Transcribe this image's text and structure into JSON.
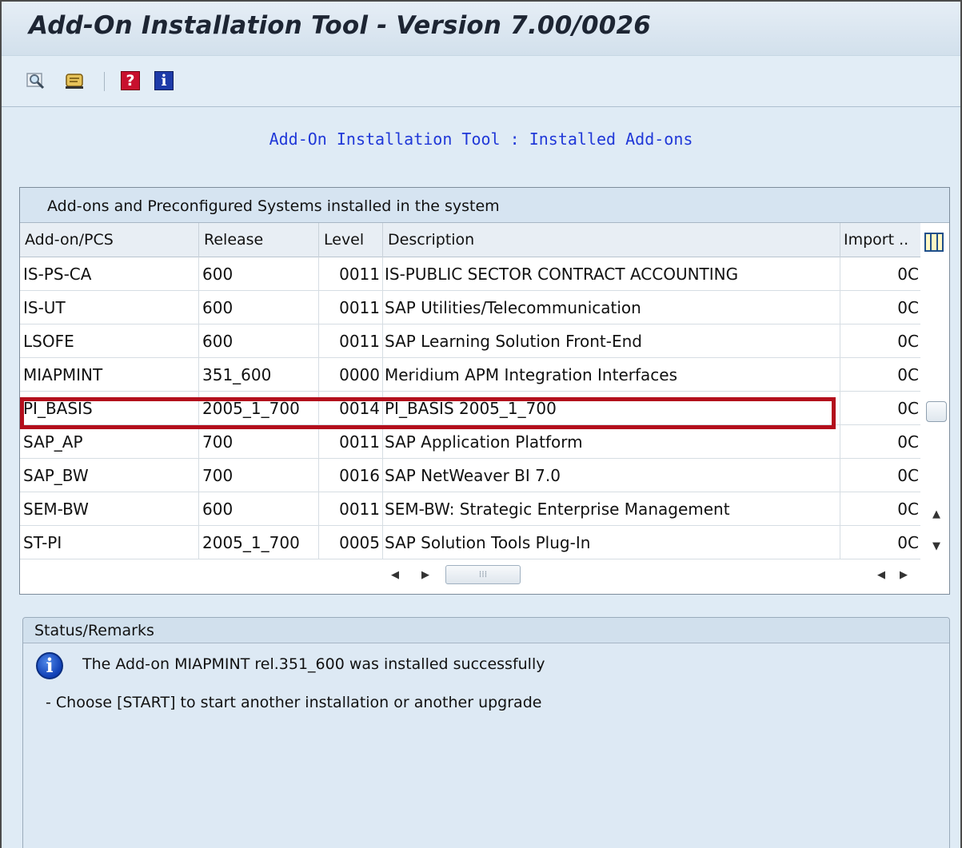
{
  "window": {
    "title": "Add-On Installation Tool - Version 7.00/0026"
  },
  "toolbar": {
    "icons": [
      "find-icon",
      "scroll-icon",
      "help-icon",
      "info-icon"
    ]
  },
  "heading": "Add-On Installation Tool : Installed Add-ons",
  "panel": {
    "title": "Add-ons and Preconfigured Systems installed in the system",
    "columns": [
      "Add-on/PCS",
      "Release",
      "Level",
      "Description",
      "Import .."
    ],
    "rows": [
      {
        "addon": "IS-PS-CA",
        "release": "600",
        "level": "0011",
        "description": "IS-PUBLIC SECTOR CONTRACT ACCOUNTING",
        "import": "0C"
      },
      {
        "addon": "IS-UT",
        "release": "600",
        "level": "0011",
        "description": "SAP Utilities/Telecommunication",
        "import": "0C"
      },
      {
        "addon": "LSOFE",
        "release": "600",
        "level": "0011",
        "description": "SAP Learning Solution Front-End",
        "import": "0C"
      },
      {
        "addon": "MIAPMINT",
        "release": "351_600",
        "level": "0000",
        "description": "Meridium APM Integration Interfaces",
        "import": "0C"
      },
      {
        "addon": "PI_BASIS",
        "release": "2005_1_700",
        "level": "0014",
        "description": "PI_BASIS 2005_1_700",
        "import": "0C"
      },
      {
        "addon": "SAP_AP",
        "release": "700",
        "level": "0011",
        "description": "SAP Application Platform",
        "import": "0C"
      },
      {
        "addon": "SAP_BW",
        "release": "700",
        "level": "0016",
        "description": "SAP NetWeaver BI 7.0",
        "import": "0C"
      },
      {
        "addon": "SEM-BW",
        "release": "600",
        "level": "0011",
        "description": "SEM-BW: Strategic Enterprise Management",
        "import": "0C"
      },
      {
        "addon": "ST-PI",
        "release": "2005_1_700",
        "level": "0005",
        "description": "SAP Solution Tools Plug-In",
        "import": "0C"
      }
    ],
    "highlighted_row": "MIAPMINT"
  },
  "status": {
    "title": "Status/Remarks",
    "message": "The Add-on MIAPMINT rel.351_600 was installed successfully",
    "hint": "- Choose [START] to start another installation or another upgrade"
  },
  "colors": {
    "highlight": "#b30f1c",
    "heading": "#2038d8",
    "panel_bg": "#dfebf5"
  }
}
